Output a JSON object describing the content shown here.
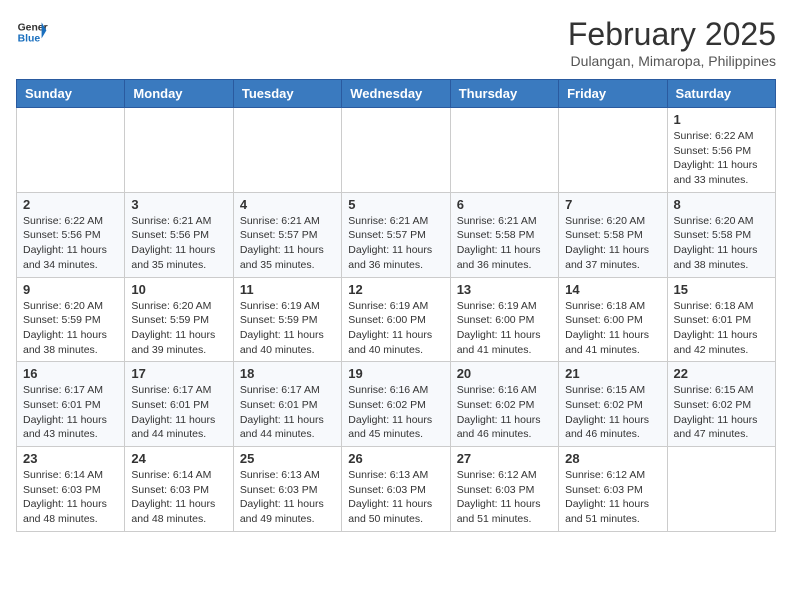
{
  "header": {
    "logo": {
      "general": "General",
      "blue": "Blue"
    },
    "month_year": "February 2025",
    "location": "Dulangan, Mimaropa, Philippines"
  },
  "calendar": {
    "days_of_week": [
      "Sunday",
      "Monday",
      "Tuesday",
      "Wednesday",
      "Thursday",
      "Friday",
      "Saturday"
    ],
    "weeks": [
      [
        {
          "day": "",
          "info": ""
        },
        {
          "day": "",
          "info": ""
        },
        {
          "day": "",
          "info": ""
        },
        {
          "day": "",
          "info": ""
        },
        {
          "day": "",
          "info": ""
        },
        {
          "day": "",
          "info": ""
        },
        {
          "day": "1",
          "info": "Sunrise: 6:22 AM\nSunset: 5:56 PM\nDaylight: 11 hours\nand 33 minutes."
        }
      ],
      [
        {
          "day": "2",
          "info": "Sunrise: 6:22 AM\nSunset: 5:56 PM\nDaylight: 11 hours\nand 34 minutes."
        },
        {
          "day": "3",
          "info": "Sunrise: 6:21 AM\nSunset: 5:56 PM\nDaylight: 11 hours\nand 35 minutes."
        },
        {
          "day": "4",
          "info": "Sunrise: 6:21 AM\nSunset: 5:57 PM\nDaylight: 11 hours\nand 35 minutes."
        },
        {
          "day": "5",
          "info": "Sunrise: 6:21 AM\nSunset: 5:57 PM\nDaylight: 11 hours\nand 36 minutes."
        },
        {
          "day": "6",
          "info": "Sunrise: 6:21 AM\nSunset: 5:58 PM\nDaylight: 11 hours\nand 36 minutes."
        },
        {
          "day": "7",
          "info": "Sunrise: 6:20 AM\nSunset: 5:58 PM\nDaylight: 11 hours\nand 37 minutes."
        },
        {
          "day": "8",
          "info": "Sunrise: 6:20 AM\nSunset: 5:58 PM\nDaylight: 11 hours\nand 38 minutes."
        }
      ],
      [
        {
          "day": "9",
          "info": "Sunrise: 6:20 AM\nSunset: 5:59 PM\nDaylight: 11 hours\nand 38 minutes."
        },
        {
          "day": "10",
          "info": "Sunrise: 6:20 AM\nSunset: 5:59 PM\nDaylight: 11 hours\nand 39 minutes."
        },
        {
          "day": "11",
          "info": "Sunrise: 6:19 AM\nSunset: 5:59 PM\nDaylight: 11 hours\nand 40 minutes."
        },
        {
          "day": "12",
          "info": "Sunrise: 6:19 AM\nSunset: 6:00 PM\nDaylight: 11 hours\nand 40 minutes."
        },
        {
          "day": "13",
          "info": "Sunrise: 6:19 AM\nSunset: 6:00 PM\nDaylight: 11 hours\nand 41 minutes."
        },
        {
          "day": "14",
          "info": "Sunrise: 6:18 AM\nSunset: 6:00 PM\nDaylight: 11 hours\nand 41 minutes."
        },
        {
          "day": "15",
          "info": "Sunrise: 6:18 AM\nSunset: 6:01 PM\nDaylight: 11 hours\nand 42 minutes."
        }
      ],
      [
        {
          "day": "16",
          "info": "Sunrise: 6:17 AM\nSunset: 6:01 PM\nDaylight: 11 hours\nand 43 minutes."
        },
        {
          "day": "17",
          "info": "Sunrise: 6:17 AM\nSunset: 6:01 PM\nDaylight: 11 hours\nand 44 minutes."
        },
        {
          "day": "18",
          "info": "Sunrise: 6:17 AM\nSunset: 6:01 PM\nDaylight: 11 hours\nand 44 minutes."
        },
        {
          "day": "19",
          "info": "Sunrise: 6:16 AM\nSunset: 6:02 PM\nDaylight: 11 hours\nand 45 minutes."
        },
        {
          "day": "20",
          "info": "Sunrise: 6:16 AM\nSunset: 6:02 PM\nDaylight: 11 hours\nand 46 minutes."
        },
        {
          "day": "21",
          "info": "Sunrise: 6:15 AM\nSunset: 6:02 PM\nDaylight: 11 hours\nand 46 minutes."
        },
        {
          "day": "22",
          "info": "Sunrise: 6:15 AM\nSunset: 6:02 PM\nDaylight: 11 hours\nand 47 minutes."
        }
      ],
      [
        {
          "day": "23",
          "info": "Sunrise: 6:14 AM\nSunset: 6:03 PM\nDaylight: 11 hours\nand 48 minutes."
        },
        {
          "day": "24",
          "info": "Sunrise: 6:14 AM\nSunset: 6:03 PM\nDaylight: 11 hours\nand 48 minutes."
        },
        {
          "day": "25",
          "info": "Sunrise: 6:13 AM\nSunset: 6:03 PM\nDaylight: 11 hours\nand 49 minutes."
        },
        {
          "day": "26",
          "info": "Sunrise: 6:13 AM\nSunset: 6:03 PM\nDaylight: 11 hours\nand 50 minutes."
        },
        {
          "day": "27",
          "info": "Sunrise: 6:12 AM\nSunset: 6:03 PM\nDaylight: 11 hours\nand 51 minutes."
        },
        {
          "day": "28",
          "info": "Sunrise: 6:12 AM\nSunset: 6:03 PM\nDaylight: 11 hours\nand 51 minutes."
        },
        {
          "day": "",
          "info": ""
        }
      ]
    ]
  }
}
